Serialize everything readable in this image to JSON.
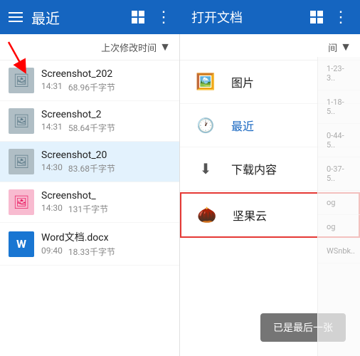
{
  "left_header": {
    "title": "最近",
    "menu_icon": "☰",
    "grid_icon": "⊞",
    "more_icon": "⋮"
  },
  "sort_bar": {
    "label": "上次修改时间",
    "arrow": "▼"
  },
  "files": [
    {
      "name": "Screenshot_202",
      "time": "14:31",
      "size": "68.96千字节",
      "thumb_type": "image"
    },
    {
      "name": "Screenshot_2",
      "time": "14:31",
      "size": "58.64千字节",
      "thumb_type": "image"
    },
    {
      "name": "Screenshot_20",
      "time": "14:30",
      "size": "83.68千字节",
      "thumb_type": "image",
      "selected": true
    },
    {
      "name": "Screenshot_",
      "time": "14:30",
      "size": "131千字节",
      "thumb_type": "pink"
    },
    {
      "name": "Word文档.docx",
      "time": "09:40",
      "size": "18.33千字节",
      "thumb_type": "word"
    }
  ],
  "dialog": {
    "title": "打开文档",
    "more_icon": "⊞",
    "dots_icon": "⋮",
    "menu_items": [
      {
        "label": "图片",
        "icon": "🖼️",
        "type": "image"
      },
      {
        "label": "最近",
        "icon": "🕐",
        "type": "recent",
        "blue": true
      },
      {
        "label": "下载内容",
        "icon": "⬇",
        "type": "download"
      },
      {
        "label": "坚果云",
        "icon": "🌰",
        "type": "jianguoyun",
        "highlighted": true
      }
    ],
    "already_last_btn": "已是最后一张"
  },
  "bg_files": [
    {
      "name": "1-23-3..",
      "date": ""
    },
    {
      "name": "1-18-5..",
      "date": ""
    },
    {
      "name": "0-44-5..",
      "date": ""
    },
    {
      "name": "0-37-5..",
      "date": ""
    },
    {
      "name": "og",
      "date": ""
    },
    {
      "name": "og",
      "date": ""
    },
    {
      "name": "WSnbk..",
      "date": ""
    }
  ],
  "right_sort": {
    "label": "间",
    "arrow": "▼"
  }
}
